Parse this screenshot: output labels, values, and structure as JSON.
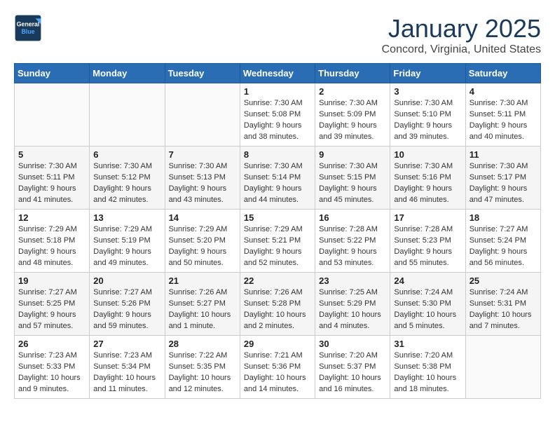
{
  "header": {
    "logo_line1": "General",
    "logo_line2": "Blue",
    "title": "January 2025",
    "location": "Concord, Virginia, United States"
  },
  "days_of_week": [
    "Sunday",
    "Monday",
    "Tuesday",
    "Wednesday",
    "Thursday",
    "Friday",
    "Saturday"
  ],
  "weeks": [
    [
      {
        "day": "",
        "info": ""
      },
      {
        "day": "",
        "info": ""
      },
      {
        "day": "",
        "info": ""
      },
      {
        "day": "1",
        "info": "Sunrise: 7:30 AM\nSunset: 5:08 PM\nDaylight: 9 hours\nand 38 minutes."
      },
      {
        "day": "2",
        "info": "Sunrise: 7:30 AM\nSunset: 5:09 PM\nDaylight: 9 hours\nand 39 minutes."
      },
      {
        "day": "3",
        "info": "Sunrise: 7:30 AM\nSunset: 5:10 PM\nDaylight: 9 hours\nand 39 minutes."
      },
      {
        "day": "4",
        "info": "Sunrise: 7:30 AM\nSunset: 5:11 PM\nDaylight: 9 hours\nand 40 minutes."
      }
    ],
    [
      {
        "day": "5",
        "info": "Sunrise: 7:30 AM\nSunset: 5:11 PM\nDaylight: 9 hours\nand 41 minutes."
      },
      {
        "day": "6",
        "info": "Sunrise: 7:30 AM\nSunset: 5:12 PM\nDaylight: 9 hours\nand 42 minutes."
      },
      {
        "day": "7",
        "info": "Sunrise: 7:30 AM\nSunset: 5:13 PM\nDaylight: 9 hours\nand 43 minutes."
      },
      {
        "day": "8",
        "info": "Sunrise: 7:30 AM\nSunset: 5:14 PM\nDaylight: 9 hours\nand 44 minutes."
      },
      {
        "day": "9",
        "info": "Sunrise: 7:30 AM\nSunset: 5:15 PM\nDaylight: 9 hours\nand 45 minutes."
      },
      {
        "day": "10",
        "info": "Sunrise: 7:30 AM\nSunset: 5:16 PM\nDaylight: 9 hours\nand 46 minutes."
      },
      {
        "day": "11",
        "info": "Sunrise: 7:30 AM\nSunset: 5:17 PM\nDaylight: 9 hours\nand 47 minutes."
      }
    ],
    [
      {
        "day": "12",
        "info": "Sunrise: 7:29 AM\nSunset: 5:18 PM\nDaylight: 9 hours\nand 48 minutes."
      },
      {
        "day": "13",
        "info": "Sunrise: 7:29 AM\nSunset: 5:19 PM\nDaylight: 9 hours\nand 49 minutes."
      },
      {
        "day": "14",
        "info": "Sunrise: 7:29 AM\nSunset: 5:20 PM\nDaylight: 9 hours\nand 50 minutes."
      },
      {
        "day": "15",
        "info": "Sunrise: 7:29 AM\nSunset: 5:21 PM\nDaylight: 9 hours\nand 52 minutes."
      },
      {
        "day": "16",
        "info": "Sunrise: 7:28 AM\nSunset: 5:22 PM\nDaylight: 9 hours\nand 53 minutes."
      },
      {
        "day": "17",
        "info": "Sunrise: 7:28 AM\nSunset: 5:23 PM\nDaylight: 9 hours\nand 55 minutes."
      },
      {
        "day": "18",
        "info": "Sunrise: 7:27 AM\nSunset: 5:24 PM\nDaylight: 9 hours\nand 56 minutes."
      }
    ],
    [
      {
        "day": "19",
        "info": "Sunrise: 7:27 AM\nSunset: 5:25 PM\nDaylight: 9 hours\nand 57 minutes."
      },
      {
        "day": "20",
        "info": "Sunrise: 7:27 AM\nSunset: 5:26 PM\nDaylight: 9 hours\nand 59 minutes."
      },
      {
        "day": "21",
        "info": "Sunrise: 7:26 AM\nSunset: 5:27 PM\nDaylight: 10 hours\nand 1 minute."
      },
      {
        "day": "22",
        "info": "Sunrise: 7:26 AM\nSunset: 5:28 PM\nDaylight: 10 hours\nand 2 minutes."
      },
      {
        "day": "23",
        "info": "Sunrise: 7:25 AM\nSunset: 5:29 PM\nDaylight: 10 hours\nand 4 minutes."
      },
      {
        "day": "24",
        "info": "Sunrise: 7:24 AM\nSunset: 5:30 PM\nDaylight: 10 hours\nand 5 minutes."
      },
      {
        "day": "25",
        "info": "Sunrise: 7:24 AM\nSunset: 5:31 PM\nDaylight: 10 hours\nand 7 minutes."
      }
    ],
    [
      {
        "day": "26",
        "info": "Sunrise: 7:23 AM\nSunset: 5:33 PM\nDaylight: 10 hours\nand 9 minutes."
      },
      {
        "day": "27",
        "info": "Sunrise: 7:23 AM\nSunset: 5:34 PM\nDaylight: 10 hours\nand 11 minutes."
      },
      {
        "day": "28",
        "info": "Sunrise: 7:22 AM\nSunset: 5:35 PM\nDaylight: 10 hours\nand 12 minutes."
      },
      {
        "day": "29",
        "info": "Sunrise: 7:21 AM\nSunset: 5:36 PM\nDaylight: 10 hours\nand 14 minutes."
      },
      {
        "day": "30",
        "info": "Sunrise: 7:20 AM\nSunset: 5:37 PM\nDaylight: 10 hours\nand 16 minutes."
      },
      {
        "day": "31",
        "info": "Sunrise: 7:20 AM\nSunset: 5:38 PM\nDaylight: 10 hours\nand 18 minutes."
      },
      {
        "day": "",
        "info": ""
      }
    ]
  ]
}
